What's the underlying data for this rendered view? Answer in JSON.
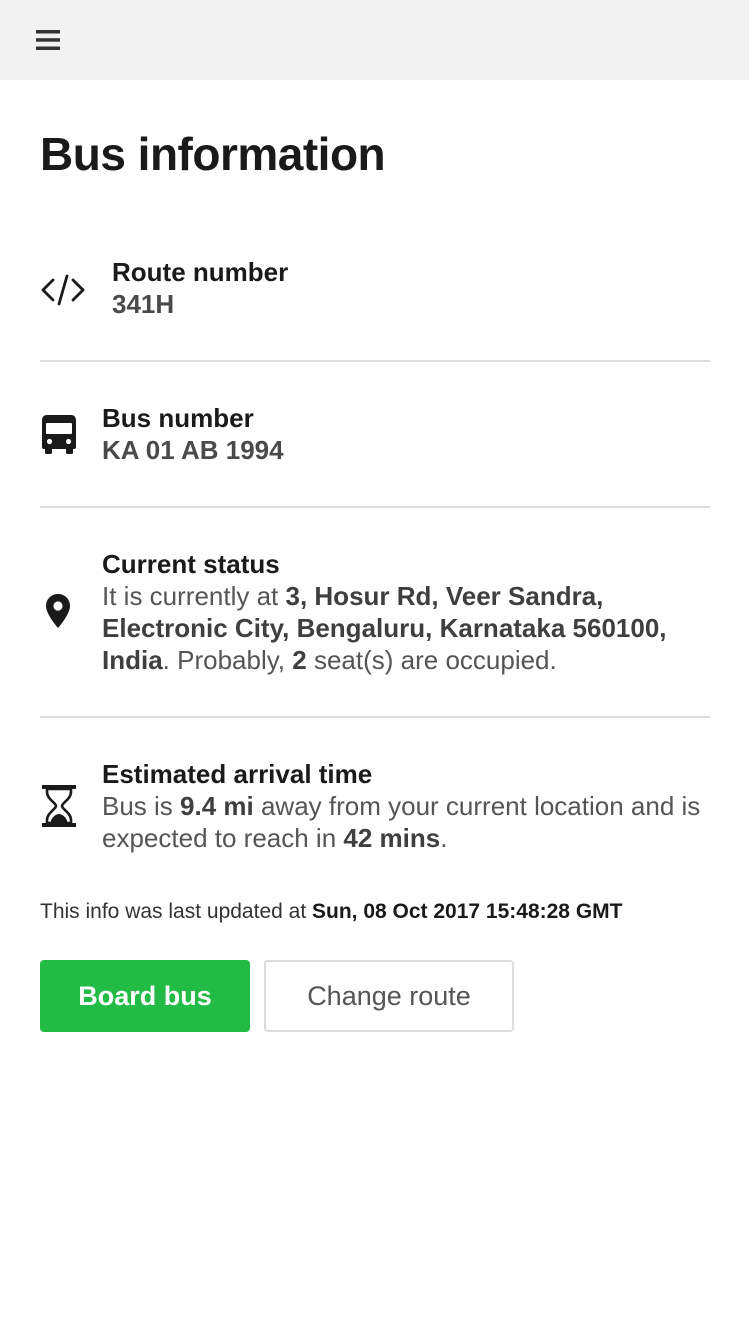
{
  "header": {
    "menu_icon": "hamburger-menu-icon"
  },
  "page_title": "Bus information",
  "route": {
    "icon": "code-icon",
    "label": "Route number",
    "value": "341H"
  },
  "bus": {
    "icon": "bus-icon",
    "label": "Bus number",
    "value": "KA 01 AB 1994"
  },
  "status": {
    "icon": "location-pin-icon",
    "label": "Current status",
    "prefix": "It is currently at ",
    "location": "3, Hosur Rd, Veer Sandra, Electronic City, Bengaluru, Karnataka 560100, India",
    "middle": ". Probably, ",
    "seats": "2",
    "suffix": " seat(s) are occupied."
  },
  "eta": {
    "icon": "hourglass-icon",
    "label": "Estimated arrival time",
    "prefix": "Bus is ",
    "distance": "9.4 mi",
    "middle": " away from your current location and is expected to reach in ",
    "time": "42 mins",
    "suffix": "."
  },
  "updated": {
    "prefix": "This info was last updated at ",
    "timestamp": "Sun, 08 Oct 2017 15:48:28 GMT"
  },
  "actions": {
    "board_label": "Board bus",
    "change_label": "Change route"
  },
  "colors": {
    "primary": "#22bb45",
    "topbar": "#f2f2f2",
    "divider": "#dedede"
  }
}
